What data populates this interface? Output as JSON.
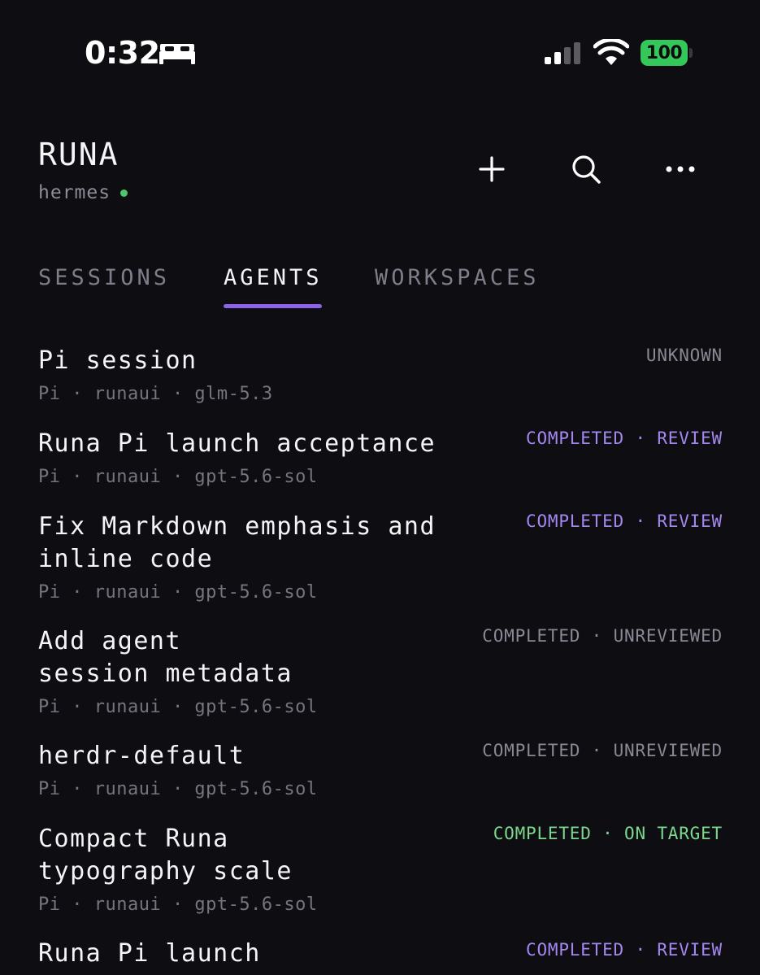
{
  "status_bar": {
    "time": "0:32",
    "battery": "100"
  },
  "header": {
    "title": "RUNA",
    "host": "hermes"
  },
  "tabs": [
    {
      "label": "SESSIONS"
    },
    {
      "label": "AGENTS"
    },
    {
      "label": "WORKSPACES"
    }
  ],
  "agents": [
    {
      "title": "Pi session",
      "meta": "Pi · runaui · glm-5.3",
      "status": "UNKNOWN"
    },
    {
      "title": "Runa Pi launch acceptance",
      "meta": "Pi · runaui · gpt-5.6-sol",
      "status": "COMPLETED · REVIEW"
    },
    {
      "title": "Fix Markdown emphasis and\ninline code",
      "meta": "Pi · runaui · gpt-5.6-sol",
      "status": "COMPLETED · REVIEW"
    },
    {
      "title": "Add agent\nsession metadata",
      "meta": "Pi · runaui · gpt-5.6-sol",
      "status": "COMPLETED · UNREVIEWED"
    },
    {
      "title": "herdr-default",
      "meta": "Pi · runaui · gpt-5.6-sol",
      "status": "COMPLETED · UNREVIEWED"
    },
    {
      "title": "Compact Runa\ntypography scale",
      "meta": "Pi · runaui · gpt-5.6-sol",
      "status": "COMPLETED · ON TARGET"
    },
    {
      "title": "Runa Pi launch",
      "meta": "",
      "status": "COMPLETED · REVIEW"
    }
  ],
  "colors": {
    "background": "#0e0d12",
    "accent": "#8b63e6",
    "review": "#a488f0",
    "unreviewed": "#8a8894",
    "on_target": "#7cd88e",
    "online": "#4cc86a",
    "battery": "#34c759"
  },
  "icons": [
    "bed-icon",
    "cellular-signal-icon",
    "wifi-icon",
    "battery-icon",
    "plus-icon",
    "search-icon",
    "more-icon"
  ]
}
